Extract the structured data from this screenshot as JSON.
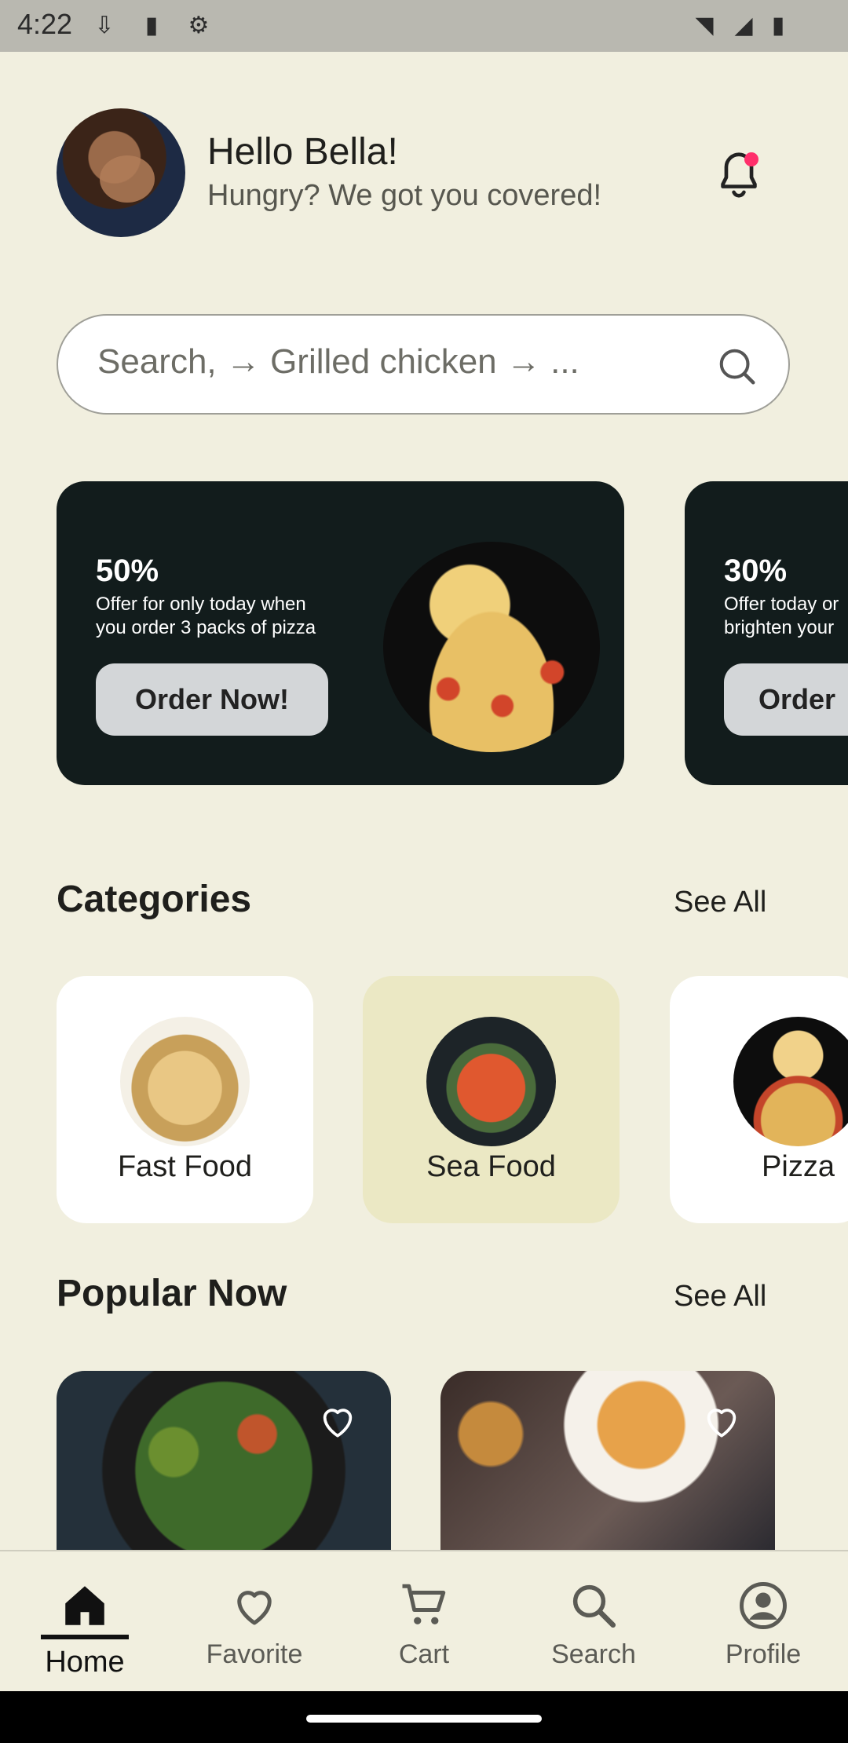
{
  "status_bar": {
    "time": "4:22",
    "icons": [
      "download-icon",
      "sd-card-icon",
      "settings-icon",
      "wifi-icon",
      "signal-icon",
      "battery-icon"
    ]
  },
  "header": {
    "greeting": "Hello Bella!",
    "subtitle": "Hungry? We got you covered!",
    "notification_dot_color": "#ff2f6b"
  },
  "search": {
    "placeholder": "Search, → Grilled chicken → ..."
  },
  "promos": [
    {
      "percent": "50%",
      "text_line1": "Offer for only today when",
      "text_line2": "you order 3 packs of pizza",
      "button": "Order Now!"
    },
    {
      "percent": "30%",
      "text_line1": "Offer today or",
      "text_line2": "brighten your",
      "button": "Order"
    }
  ],
  "categories": {
    "title": "Categories",
    "see_all": "See All",
    "items": [
      {
        "label": "Fast Food",
        "selected": false
      },
      {
        "label": "Sea Food",
        "selected": true
      },
      {
        "label": "Pizza",
        "selected": false
      }
    ]
  },
  "popular": {
    "title": "Popular Now",
    "see_all": "See All"
  },
  "bottom_nav": {
    "active": "Home",
    "items": [
      {
        "label": "Home",
        "icon": "home-icon"
      },
      {
        "label": "Favorite",
        "icon": "heart-icon"
      },
      {
        "label": "Cart",
        "icon": "cart-icon"
      },
      {
        "label": "Search",
        "icon": "search-icon"
      },
      {
        "label": "Profile",
        "icon": "profile-icon"
      }
    ]
  },
  "colors": {
    "background": "#f1efdf",
    "promo_card": "#121c1c",
    "selected_category": "#ebe8c4",
    "accent_dot": "#ff2f6b"
  }
}
